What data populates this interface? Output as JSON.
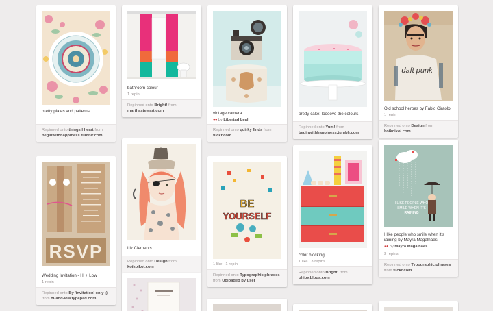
{
  "pins": [
    {
      "description": "pretty plates and patterns",
      "stats": "",
      "by": "",
      "repinned_prefix": "Repinned onto",
      "board": "things I heart",
      "from_word": "from",
      "source": "beginwithhappiness.tumblr.com"
    },
    {
      "description": "Wedding Invitation - Hi + Low",
      "stats": "1 repin",
      "by": "",
      "repinned_prefix": "Repinned onto",
      "board": "By 'invitation' only ;)",
      "from_word": "from",
      "source": "hi-and-low.typepad.com"
    },
    {
      "description": "bathroom colour",
      "stats": "1 repin",
      "by": "",
      "repinned_prefix": "Repinned onto",
      "board": "Bright!",
      "from_word": "from",
      "source": "marthastewart.com"
    },
    {
      "description": "Liz Clements",
      "stats": "",
      "by": "",
      "repinned_prefix": "Repinned onto",
      "board": "Design",
      "from_word": "from",
      "source": "koikoikoi.com"
    },
    {
      "description": "vintage camera",
      "stats": "",
      "by_prefix": "by",
      "by": "Libertad Leal",
      "repinned_prefix": "Repinned onto",
      "board": "quirky finds",
      "from_word": "from",
      "source": "flickr.com"
    },
    {
      "description": "",
      "stats": "1 like   1 repin",
      "by": "",
      "repinned_prefix": "Repinned onto",
      "board": "Typographic phrases",
      "from_word": "from",
      "source": "Uploaded by user"
    },
    {
      "description": "pretty cake: loooove the colours.",
      "stats": "",
      "by": "",
      "repinned_prefix": "Repinned onto",
      "board": "Yum!",
      "from_word": "from",
      "source": "beginwithhappiness.tumblr.com"
    },
    {
      "description": "color blocking...",
      "stats": "1 like   3 repins",
      "by": "",
      "repinned_prefix": "Repinned onto",
      "board": "Bright!",
      "from_word": "from",
      "source": "ohjoy.blogs.com"
    },
    {
      "description": "Old school heroes by Fabio Ciraolo",
      "stats": "1 repin",
      "by": "",
      "repinned_prefix": "Repinned onto",
      "board": "Design",
      "from_word": "from",
      "source": "koikoikoi.com"
    },
    {
      "description": "I like people who smile when it's raining by Mayra Magalhães",
      "stats": "3 repins",
      "by_prefix": "by",
      "by": "Mayra Magalhães",
      "repinned_prefix": "Repinned onto",
      "board": "Typographic phrases",
      "from_word": "from",
      "source": "flickr.com"
    }
  ],
  "artwork_text": {
    "rsvp": "RSVP",
    "be_yourself": "BE YOURSELF",
    "rain_text": "I LIKE PEOPLE WHO SMILE WHEN IT'S RAINING",
    "daft_punk": "daft punk"
  },
  "colors": {
    "background": "#eeecec",
    "card": "#ffffff",
    "attribution_bg": "#f5f3f3",
    "link": "#524d4d",
    "muted": "#a19b9b"
  }
}
